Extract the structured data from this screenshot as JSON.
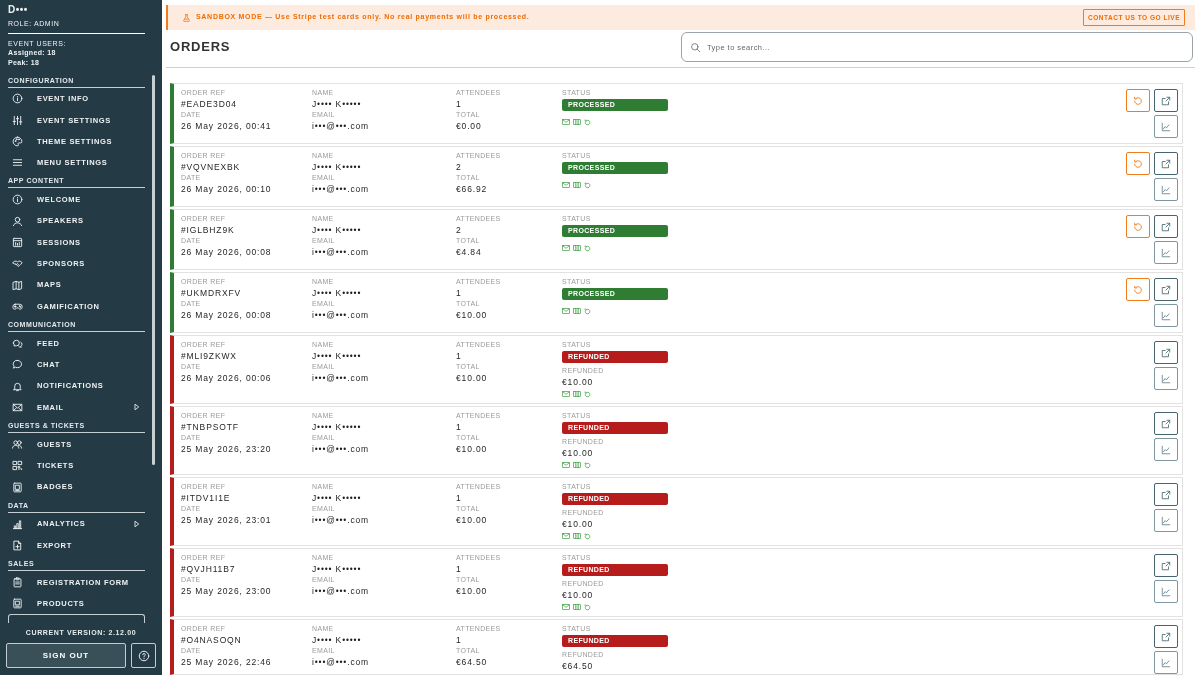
{
  "sidebar": {
    "org_name": "D•••",
    "role": "ROLE: ADMIN",
    "users_heading": "EVENT USERS:",
    "assigned": "Assigned: 18",
    "peak": "Peak: 18",
    "sections": [
      {
        "title": "CONFIGURATION",
        "items": [
          {
            "label": "EVENT INFO",
            "has_submenu": false
          },
          {
            "label": "EVENT SETTINGS",
            "has_submenu": false
          },
          {
            "label": "THEME SETTINGS",
            "has_submenu": false
          },
          {
            "label": "MENU SETTINGS",
            "has_submenu": false
          }
        ]
      },
      {
        "title": "APP CONTENT",
        "items": [
          {
            "label": "WELCOME",
            "has_submenu": false
          },
          {
            "label": "SPEAKERS",
            "has_submenu": false
          },
          {
            "label": "SESSIONS",
            "has_submenu": false
          },
          {
            "label": "SPONSORS",
            "has_submenu": false
          },
          {
            "label": "MAPS",
            "has_submenu": false
          },
          {
            "label": "GAMIFICATION",
            "has_submenu": false
          }
        ]
      },
      {
        "title": "COMMUNICATION",
        "items": [
          {
            "label": "FEED",
            "has_submenu": false
          },
          {
            "label": "CHAT",
            "has_submenu": false
          },
          {
            "label": "NOTIFICATIONS",
            "has_submenu": false
          },
          {
            "label": "EMAIL",
            "has_submenu": true
          }
        ]
      },
      {
        "title": "GUESTS & TICKETS",
        "items": [
          {
            "label": "GUESTS",
            "has_submenu": false
          },
          {
            "label": "TICKETS",
            "has_submenu": false
          },
          {
            "label": "BADGES",
            "has_submenu": false
          }
        ]
      },
      {
        "title": "DATA",
        "items": [
          {
            "label": "ANALYTICS",
            "has_submenu": true
          },
          {
            "label": "EXPORT",
            "has_submenu": false
          }
        ]
      },
      {
        "title": "SALES",
        "items": [
          {
            "label": "REGISTRATION FORM",
            "has_submenu": false
          },
          {
            "label": "PRODUCTS",
            "has_submenu": false
          }
        ]
      }
    ],
    "version": "CURRENT VERSION: 2.12.00",
    "sign_out": "SIGN OUT"
  },
  "banner": {
    "text": "SANDBOX MODE — Use Stripe test cards only. No real payments will be processed.",
    "button": "CONTACT US TO GO LIVE"
  },
  "header": {
    "title": "ORDERS",
    "search": {
      "placeholder": "Type to search..."
    }
  },
  "orders": [
    {
      "ref_label": "ORDER REF",
      "ref": "#EADE3D04",
      "date_label": "DATE",
      "date": "26 May 2026, 00:41",
      "name_label": "NAME",
      "name": "J•••• K•••••",
      "email_label": "EMAIL",
      "email": "i•••@•••.com",
      "attendees_label": "ATTENDEES",
      "attendees": "1",
      "total_label": "TOTAL",
      "total": "€0.00",
      "status_label": "STATUS",
      "status": {
        "kind": "processed",
        "text": "PROCESSED"
      },
      "status_icons": true
    },
    {
      "ref_label": "ORDER REF",
      "ref": "#VQVNEXBK",
      "date_label": "DATE",
      "date": "26 May 2026, 00:10",
      "name_label": "NAME",
      "name": "J•••• K•••••",
      "email_label": "EMAIL",
      "email": "i•••@•••.com",
      "attendees_label": "ATTENDEES",
      "attendees": "2",
      "total_label": "TOTAL",
      "total": "€66.92",
      "status_label": "STATUS",
      "status": {
        "kind": "processed",
        "text": "PROCESSED"
      },
      "status_icons": true
    },
    {
      "ref_label": "ORDER REF",
      "ref": "#IGLBHZ9K",
      "date_label": "DATE",
      "date": "26 May 2026, 00:08",
      "name_label": "NAME",
      "name": "J•••• K•••••",
      "email_label": "EMAIL",
      "email": "i•••@•••.com",
      "attendees_label": "ATTENDEES",
      "attendees": "2",
      "total_label": "TOTAL",
      "total": "€4.84",
      "status_label": "STATUS",
      "status": {
        "kind": "processed",
        "text": "PROCESSED"
      },
      "status_icons": true
    },
    {
      "ref_label": "ORDER REF",
      "ref": "#UKMDRXFV",
      "date_label": "DATE",
      "date": "26 May 2026, 00:08",
      "name_label": "NAME",
      "name": "J•••• K•••••",
      "email_label": "EMAIL",
      "email": "i•••@•••.com",
      "attendees_label": "ATTENDEES",
      "attendees": "1",
      "total_label": "TOTAL",
      "total": "€10.00",
      "status_label": "STATUS",
      "status": {
        "kind": "processed",
        "text": "PROCESSED"
      },
      "status_icons": true
    },
    {
      "ref_label": "ORDER REF",
      "ref": "#MLI9ZKWX",
      "date_label": "DATE",
      "date": "26 May 2026, 00:06",
      "name_label": "NAME",
      "name": "J•••• K•••••",
      "email_label": "EMAIL",
      "email": "i•••@•••.com",
      "attendees_label": "ATTENDEES",
      "attendees": "1",
      "total_label": "TOTAL",
      "total": "€10.00",
      "status_label": "STATUS",
      "status": {
        "kind": "refunded",
        "text": "REFUNDED"
      },
      "refunded_label": "REFUNDED",
      "refunded": "€10.00",
      "status_icons": true
    },
    {
      "ref_label": "ORDER REF",
      "ref": "#TNBPSOTF",
      "date_label": "DATE",
      "date": "25 May 2026, 23:20",
      "name_label": "NAME",
      "name": "J•••• K•••••",
      "email_label": "EMAIL",
      "email": "i•••@•••.com",
      "attendees_label": "ATTENDEES",
      "attendees": "1",
      "total_label": "TOTAL",
      "total": "€10.00",
      "status_label": "STATUS",
      "status": {
        "kind": "refunded",
        "text": "REFUNDED"
      },
      "refunded_label": "REFUNDED",
      "refunded": "€10.00",
      "status_icons": true
    },
    {
      "ref_label": "ORDER REF",
      "ref": "#ITDV1I1E",
      "date_label": "DATE",
      "date": "25 May 2026, 23:01",
      "name_label": "NAME",
      "name": "J•••• K•••••",
      "email_label": "EMAIL",
      "email": "i•••@•••.com",
      "attendees_label": "ATTENDEES",
      "attendees": "1",
      "total_label": "TOTAL",
      "total": "€10.00",
      "status_label": "STATUS",
      "status": {
        "kind": "refunded",
        "text": "REFUNDED"
      },
      "refunded_label": "REFUNDED",
      "refunded": "€10.00",
      "status_icons": true
    },
    {
      "ref_label": "ORDER REF",
      "ref": "#QVJH11B7",
      "date_label": "DATE",
      "date": "25 May 2026, 23:00",
      "name_label": "NAME",
      "name": "J•••• K•••••",
      "email_label": "EMAIL",
      "email": "i•••@•••.com",
      "attendees_label": "ATTENDEES",
      "attendees": "1",
      "total_label": "TOTAL",
      "total": "€10.00",
      "status_label": "STATUS",
      "status": {
        "kind": "refunded",
        "text": "REFUNDED"
      },
      "refunded_label": "REFUNDED",
      "refunded": "€10.00",
      "status_icons": true
    },
    {
      "ref_label": "ORDER REF",
      "ref": "#O4NASOQN",
      "date_label": "DATE",
      "date": "25 May 2026, 22:46",
      "name_label": "NAME",
      "name": "J•••• K•••••",
      "email_label": "EMAIL",
      "email": "i•••@•••.com",
      "attendees_label": "ATTENDEES",
      "attendees": "1",
      "total_label": "TOTAL",
      "total": "€64.50",
      "status_label": "STATUS",
      "status": {
        "kind": "refunded",
        "text": "REFUNDED"
      },
      "refunded_label": "REFUNDED",
      "refunded": "€64.50"
    }
  ]
}
